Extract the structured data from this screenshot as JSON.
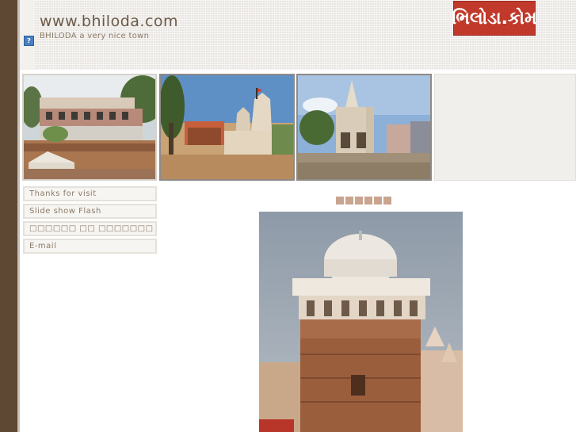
{
  "header": {
    "site_title": "www.bhiloda.com",
    "tagline": "BHILODA a very nice town",
    "logo_text": "ભિલોડા.કોમ",
    "broken_image_glyph": "?"
  },
  "menu": {
    "items": [
      {
        "label": "Thanks for visit"
      },
      {
        "label": "Slide show Flash"
      },
      {
        "label": "□□□□□□ □□ □□□□□□□"
      },
      {
        "label": "E-mail"
      }
    ]
  },
  "caption": {
    "glyph_count": 6
  },
  "colors": {
    "left_bar": "#5e4733",
    "accent": "#c0392b",
    "text_brown": "#6b5a48",
    "menu_text": "#8a7a68"
  }
}
